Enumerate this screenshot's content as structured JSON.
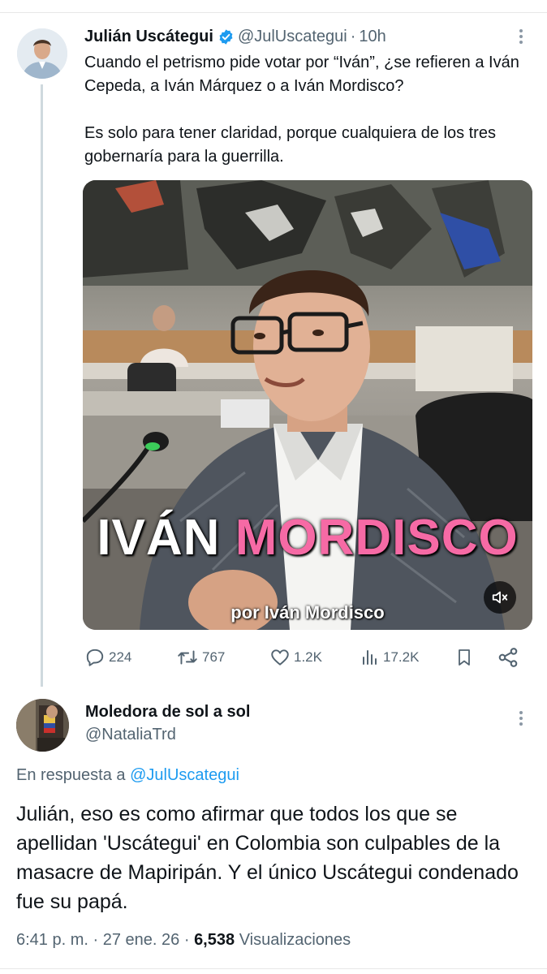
{
  "tweet": {
    "author_name": "Julián Uscátegui",
    "author_handle": "@JulUscategui",
    "time_sep": "·",
    "time": "10h",
    "text_p1": "Cuando el petrismo pide votar por “Iván”, ¿se refieren a Iván Cepeda, a Iván Márquez o a Iván Mordisco?",
    "text_p2": "Es solo para tener claridad, porque cualquiera de los tres gobernaría para la guerrilla.",
    "media": {
      "caption_word1": "IVÁN",
      "caption_word2": "MORDISCO",
      "subtitle": "por Iván Mordisco"
    },
    "stats": {
      "replies": "224",
      "reposts": "767",
      "likes": "1.2K",
      "views": "17.2K"
    }
  },
  "reply": {
    "author_name": "Moledora de sol a sol",
    "author_handle": "@NataliaTrd",
    "reply_prefix": "En respuesta a",
    "reply_to": "@JulUscategui",
    "text": "Julián, eso es como afirmar que todos los que se apellidan 'Uscátegui' en Colombia son culpables de la masacre de Mapiripán. Y el único Uscátegui condenado fue su papá.",
    "time": "6:41 p. m.",
    "date": "27 ene. 26",
    "views": "6,538",
    "views_label": "Visualizaciones",
    "sep": "·"
  },
  "colors": {
    "accent": "#1d9bf0",
    "secondary_text": "#536471",
    "caption_pink": "#f66aa5"
  },
  "icons": [
    "verified-badge-icon",
    "more-icon",
    "reply-icon",
    "repost-icon",
    "like-icon",
    "views-icon",
    "bookmark-icon",
    "share-icon",
    "mute-icon"
  ]
}
